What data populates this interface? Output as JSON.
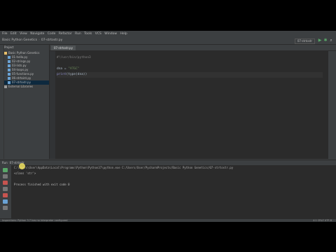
{
  "menu": [
    "File",
    "Edit",
    "View",
    "Navigate",
    "Code",
    "Refactor",
    "Run",
    "Tools",
    "VCS",
    "Window",
    "Help"
  ],
  "breadcrumb": [
    "Basic Python Genetics",
    "07-strtostr.py"
  ],
  "run_config": "07-strtostr",
  "sidebar": {
    "header": "Project",
    "items": [
      {
        "label": "Basic Python Genetics",
        "type": "folder"
      },
      {
        "label": "01-hello.py",
        "type": "py"
      },
      {
        "label": "02-strings.py",
        "type": "py"
      },
      {
        "label": "03-lists.py",
        "type": "py"
      },
      {
        "label": "04-loops.py",
        "type": "py"
      },
      {
        "label": "05-functions.py",
        "type": "py"
      },
      {
        "label": "06-strtoint.py",
        "type": "py"
      },
      {
        "label": "07-strtostr.py",
        "type": "py"
      },
      {
        "label": "External Libraries",
        "type": "folder"
      }
    ]
  },
  "editor": {
    "tab_label": "07-strtostr.py",
    "lines": [
      {
        "kind": "comment",
        "text": "#!/usr/bin/python3"
      },
      {
        "kind": "blank",
        "text": ""
      },
      {
        "kind": "assign",
        "id": "dna",
        "op": " = ",
        "str": "\"ATGC\""
      },
      {
        "kind": "print",
        "fn": "print",
        "args": "(type(dna))"
      }
    ]
  },
  "run": {
    "title": "Run",
    "config": "07-strtostr",
    "output": [
      "C:\\Users\\User\\AppData\\Local\\Programs\\Python\\Python37\\python.exe C:/Users/User/PycharmProjects/Basic Python Genetics/07-strtostr.py",
      "<class 'str'>",
      "",
      "Process finished with exit code 0"
    ]
  },
  "status": {
    "left": "Inspections: Python 3.7 has no interpreter configured",
    "right": "4:1  CRLF  UTF-8"
  }
}
